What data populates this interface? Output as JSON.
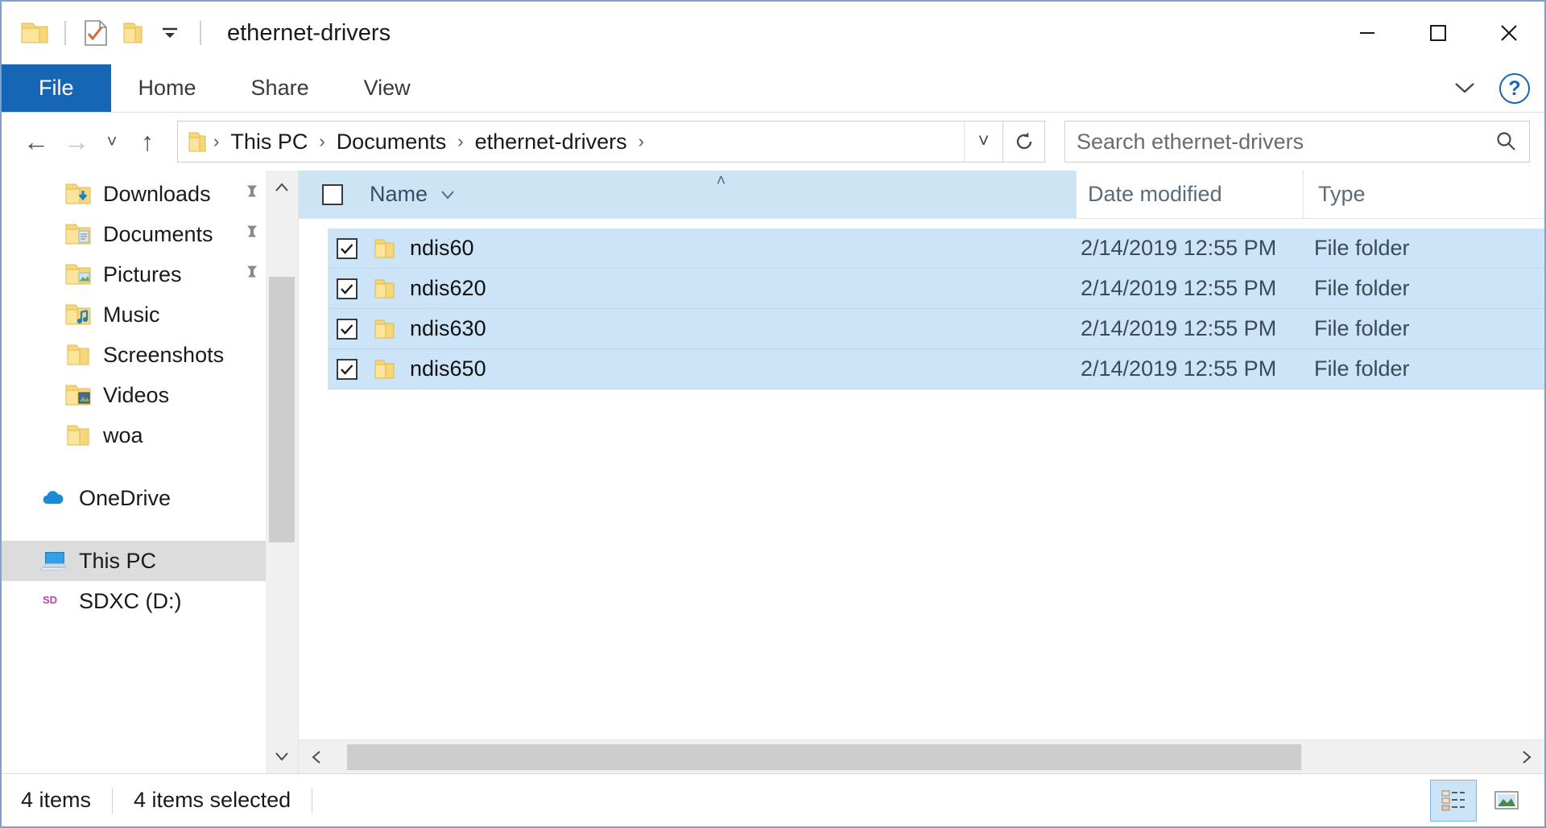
{
  "window": {
    "title": "ethernet-drivers",
    "quick_access": [
      {
        "name": "folder-icon",
        "label": "Folder"
      },
      {
        "name": "properties-icon",
        "label": "Properties"
      },
      {
        "name": "new-folder-icon",
        "label": "New folder"
      },
      {
        "name": "customize-caret-icon",
        "label": "Customize Quick Access Toolbar"
      }
    ],
    "caption": {
      "minimize": "‒",
      "maximize": "☐",
      "close": "✕"
    }
  },
  "ribbon": {
    "tabs": [
      {
        "label": "File",
        "active": true
      },
      {
        "label": "Home",
        "active": false
      },
      {
        "label": "Share",
        "active": false
      },
      {
        "label": "View",
        "active": false
      }
    ],
    "collapse_icon": "chevron-down-icon",
    "help_label": "?"
  },
  "address": {
    "back_icon": "←",
    "forward_icon": "→",
    "recent_icon": "˅",
    "up_icon": "↑",
    "crumbs": [
      "This PC",
      "Documents",
      "ethernet-drivers"
    ],
    "separator": "›",
    "dropdown_icon": "˅",
    "refresh_icon": "↻"
  },
  "search": {
    "placeholder": "Search ethernet-drivers",
    "value": "",
    "icon": "search-icon"
  },
  "sidebar": {
    "items": [
      {
        "label": "Downloads",
        "icon": "folder-downloads-icon",
        "pinned": true,
        "selected": false,
        "root": false
      },
      {
        "label": "Documents",
        "icon": "folder-documents-icon",
        "pinned": true,
        "selected": false,
        "root": false
      },
      {
        "label": "Pictures",
        "icon": "folder-pictures-icon",
        "pinned": true,
        "selected": false,
        "root": false
      },
      {
        "label": "Music",
        "icon": "folder-music-icon",
        "pinned": false,
        "selected": false,
        "root": false
      },
      {
        "label": "Screenshots",
        "icon": "folder-icon",
        "pinned": false,
        "selected": false,
        "root": false
      },
      {
        "label": "Videos",
        "icon": "folder-videos-icon",
        "pinned": false,
        "selected": false,
        "root": false
      },
      {
        "label": "woa",
        "icon": "folder-icon",
        "pinned": false,
        "selected": false,
        "root": false
      }
    ],
    "roots": [
      {
        "label": "OneDrive",
        "icon": "onedrive-cloud-icon",
        "selected": false
      },
      {
        "label": "This PC",
        "icon": "this-pc-icon",
        "selected": true
      },
      {
        "label": "SDXC (D:)",
        "icon": "sd-card-icon",
        "selected": false
      }
    ]
  },
  "filelist": {
    "columns": {
      "name": "Name",
      "date_modified": "Date modified",
      "type": "Type"
    },
    "sort_indicator": "˄",
    "header_checkbox_checked": false,
    "rows": [
      {
        "name": "ndis60",
        "date_modified": "2/14/2019 12:55 PM",
        "type": "File folder",
        "checked": true,
        "selected": true
      },
      {
        "name": "ndis620",
        "date_modified": "2/14/2019 12:55 PM",
        "type": "File folder",
        "checked": true,
        "selected": true
      },
      {
        "name": "ndis630",
        "date_modified": "2/14/2019 12:55 PM",
        "type": "File folder",
        "checked": true,
        "selected": true
      },
      {
        "name": "ndis650",
        "date_modified": "2/14/2019 12:55 PM",
        "type": "File folder",
        "checked": true,
        "selected": true
      }
    ]
  },
  "statusbar": {
    "item_count": "4 items",
    "selection_count": "4 items selected",
    "views": [
      {
        "name": "details-view-button",
        "label": "Details",
        "active": true
      },
      {
        "name": "large-icons-view-button",
        "label": "Large icons",
        "active": false
      }
    ]
  },
  "colors": {
    "accent": "#1766b5",
    "selection": "#cce4f7",
    "header": "#cde4f5",
    "folder_yellow": "#f6d278",
    "window_border": "#7da2ce"
  }
}
